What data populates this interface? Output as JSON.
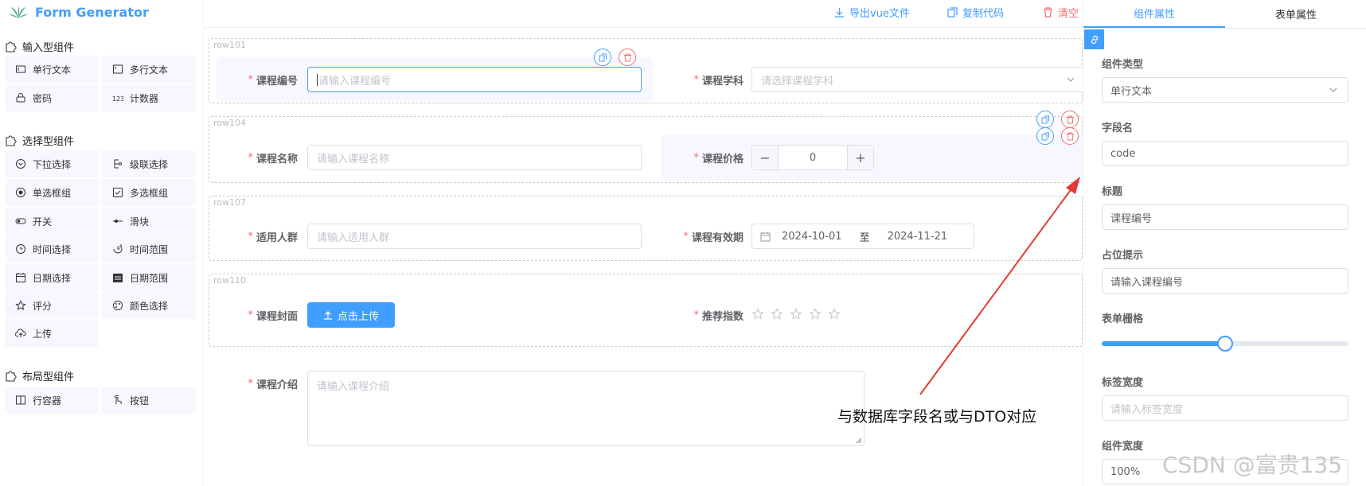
{
  "app": {
    "title": "Form Generator"
  },
  "sidebar": {
    "groups": [
      {
        "title": "输入型组件",
        "items": [
          {
            "label": "单行文本",
            "icon": "input-icon"
          },
          {
            "label": "多行文本",
            "icon": "textarea-icon"
          },
          {
            "label": "密码",
            "icon": "password-icon"
          },
          {
            "label": "计数器",
            "icon": "number-icon"
          }
        ]
      },
      {
        "title": "选择型组件",
        "items": [
          {
            "label": "下拉选择",
            "icon": "select-icon"
          },
          {
            "label": "级联选择",
            "icon": "cascader-icon"
          },
          {
            "label": "单选框组",
            "icon": "radio-icon"
          },
          {
            "label": "多选框组",
            "icon": "checkbox-icon"
          },
          {
            "label": "开关",
            "icon": "switch-icon"
          },
          {
            "label": "滑块",
            "icon": "slider-icon"
          },
          {
            "label": "时间选择",
            "icon": "time-icon"
          },
          {
            "label": "时间范围",
            "icon": "time-range-icon"
          },
          {
            "label": "日期选择",
            "icon": "date-icon"
          },
          {
            "label": "日期范围",
            "icon": "date-range-icon"
          },
          {
            "label": "评分",
            "icon": "rate-icon"
          },
          {
            "label": "颜色选择",
            "icon": "color-icon"
          },
          {
            "label": "上传",
            "icon": "upload-icon"
          }
        ]
      },
      {
        "title": "布局型组件",
        "items": [
          {
            "label": "行容器",
            "icon": "row-icon"
          },
          {
            "label": "按钮",
            "icon": "button-icon"
          }
        ]
      }
    ]
  },
  "toolbar": {
    "export_label": "导出vue文件",
    "copy_label": "复制代码",
    "clear_label": "清空"
  },
  "canvas": {
    "rows": [
      {
        "tag": "row101"
      },
      {
        "tag": "row104"
      },
      {
        "tag": "row107"
      },
      {
        "tag": "row110"
      }
    ],
    "fields": {
      "course_code": {
        "label": "课程编号",
        "placeholder": "请输入课程编号"
      },
      "course_subject": {
        "label": "课程学科",
        "placeholder": "请选择课程学科"
      },
      "course_name": {
        "label": "课程名称",
        "placeholder": "请输入课程名称"
      },
      "course_price": {
        "label": "课程价格",
        "value": "0"
      },
      "audience": {
        "label": "适用人群",
        "placeholder": "请输入适用人群"
      },
      "validity": {
        "label": "课程有效期",
        "start": "2024-10-01",
        "separator": "至",
        "end": "2024-11-21"
      },
      "cover": {
        "label": "课程封面",
        "button": "点击上传"
      },
      "rating": {
        "label": "推荐指数",
        "stars": 5
      },
      "intro": {
        "label": "课程介绍",
        "placeholder": "请输入课程介绍"
      }
    },
    "required_mark": "*"
  },
  "panel": {
    "tabs": [
      "组件属性",
      "表单属性"
    ],
    "active_tab": 0,
    "component_type": {
      "label": "组件类型",
      "value": "单行文本"
    },
    "field_name": {
      "label": "字段名",
      "value": "code"
    },
    "title": {
      "label": "标题",
      "value": "课程编号"
    },
    "placeholder": {
      "label": "占位提示",
      "value": "请输入课程编号"
    },
    "span": {
      "label": "表单栅格",
      "fraction": 0.5
    },
    "label_width": {
      "label": "标签宽度",
      "placeholder": "请输入标签宽度"
    },
    "comp_width": {
      "label": "组件宽度",
      "value": "100%"
    }
  },
  "annotation": {
    "text": "与数据库字段名或与DTO对应",
    "color": "#e53935"
  },
  "watermark": "CSDN @富贵135",
  "colors": {
    "primary": "#409eff",
    "danger": "#f56c6c",
    "hover_bg": "#f6f7ff"
  }
}
